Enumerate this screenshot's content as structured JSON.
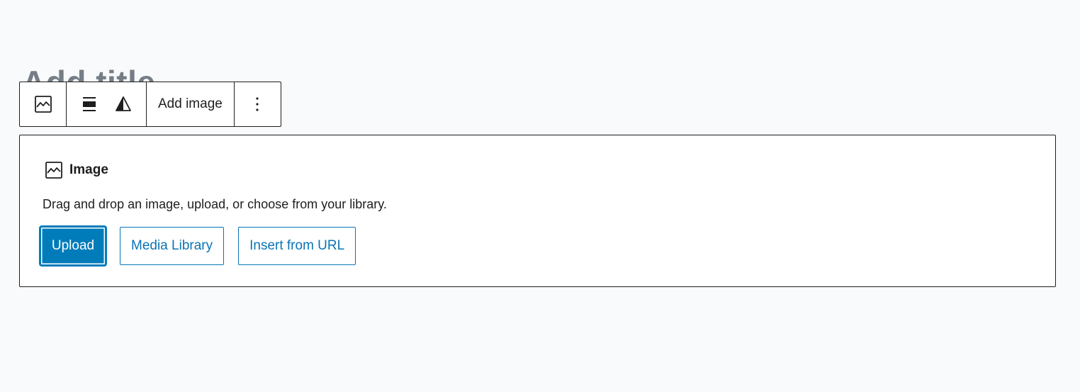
{
  "editor": {
    "title_placeholder": "Add title"
  },
  "toolbar": {
    "block_type_icon": "image-icon",
    "align_icon": "align-center-icon",
    "duotone_icon": "duotone-icon",
    "add_image_label": "Add image",
    "more_icon": "more-vertical-icon"
  },
  "placeholder": {
    "icon": "image-icon",
    "label": "Image",
    "instructions": "Drag and drop an image, upload, or choose from your library.",
    "buttons": {
      "upload": "Upload",
      "media_library": "Media Library",
      "insert_url": "Insert from URL"
    }
  },
  "colors": {
    "accent": "#007cba",
    "text": "#1e1e1e",
    "background": "#f9fafb"
  }
}
